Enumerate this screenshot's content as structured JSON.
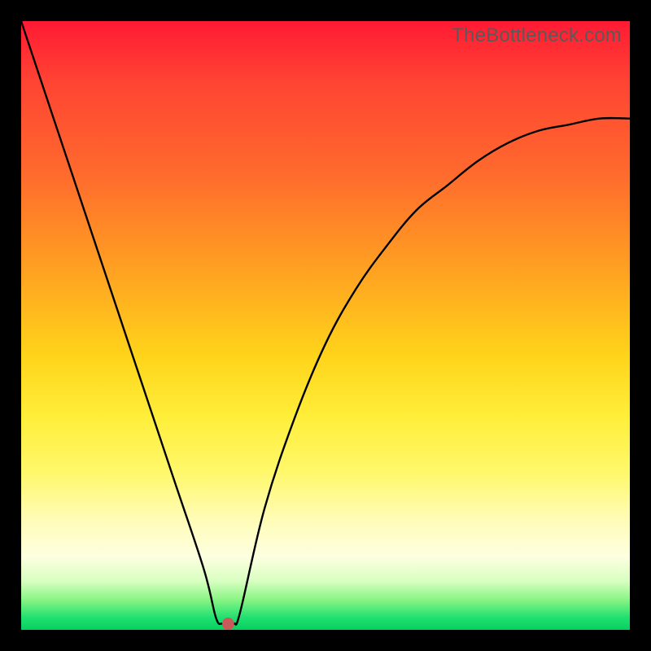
{
  "watermark": "TheBottleneck.com",
  "chart_data": {
    "type": "line",
    "title": "",
    "xlabel": "",
    "ylabel": "",
    "xlim": [
      0,
      100
    ],
    "ylim": [
      0,
      100
    ],
    "series": [
      {
        "name": "curve",
        "x": [
          0,
          5,
          10,
          15,
          20,
          25,
          30,
          32,
          33,
          34,
          35,
          36,
          40,
          45,
          50,
          55,
          60,
          65,
          70,
          75,
          80,
          85,
          90,
          95,
          100
        ],
        "values": [
          100,
          85,
          70,
          55,
          40,
          25,
          10,
          2,
          1,
          1,
          1,
          3,
          20,
          35,
          47,
          56,
          63,
          69,
          73,
          77,
          80,
          82,
          83,
          84,
          84
        ]
      }
    ],
    "marker": {
      "x": 34,
      "y": 1,
      "color": "#c85a5a"
    },
    "background": "rainbow-vertical-gradient",
    "grid": false,
    "legend": false
  },
  "colors": {
    "frame": "#000000",
    "curve": "#000000",
    "marker": "#c85a5a",
    "watermark": "#5a5a5a"
  }
}
